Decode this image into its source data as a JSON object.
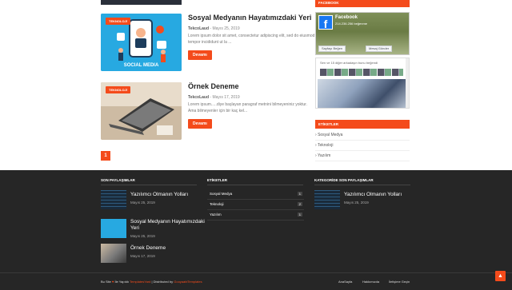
{
  "posts": [
    {
      "title": "Sosyal Medyanın Hayatımızdaki Yeri",
      "tag": "TEKNOLOJİ",
      "author": "TekcoLaud",
      "date": "Mayıs 25, 2019",
      "excerpt": "Lorem ipsum dolor sit amet, consectetur adipiscing elit, sed do eiusmod tempor incididunt ut la ...",
      "more": "Devamı",
      "thumb_label": "SOCIAL MEDIA"
    },
    {
      "title": "Örnek Deneme",
      "tag": "TEKNOLOJİ",
      "author": "TekcoLaud",
      "date": "Mayıs 17, 2019",
      "excerpt": "Lorem ipsum.....diye başlayan paragraf metnini bilmeyeniniz yoktur. Ama bilmeyenler için bir kaç kel...",
      "more": "Devamı"
    }
  ],
  "pager": {
    "current": "1"
  },
  "sidebar": {
    "facebook_head": "FACEBOOK",
    "facebook": {
      "name": "Facebook",
      "count": "214.236.256 beğenme",
      "like": "Sayfayı Beğen",
      "message": "Mesaj Gönder",
      "friends_text": "Sen ve 15 diğer arkadaşın bunu beğendi"
    },
    "labels_head": "ETİKETLER",
    "categories": [
      "Sosyal Medya",
      "Teknoloji",
      "Yazılım"
    ]
  },
  "footer": {
    "recent_head": "SON PAYLAŞIMLAR",
    "recent": [
      {
        "title": "Yazılımcı Olmanın Yolları",
        "date": "Mayıs 25, 2019"
      },
      {
        "title": "Sosyal Medyanın Hayatımızdaki",
        "title2": "Yeri",
        "date": "Mayıs 25, 2019"
      },
      {
        "title": "Örnek Deneme",
        "date": "Mayıs 17, 2019"
      }
    ],
    "labels_head": "ETİKETLER",
    "labels": [
      {
        "name": "Sosyal Medya",
        "count": "1"
      },
      {
        "name": "Teknoloji",
        "count": "2"
      },
      {
        "name": "Yazılım",
        "count": "1"
      }
    ],
    "category_head": "KATEGORİDE SON PAYLAŞIMLAR",
    "category_posts": [
      {
        "title": "Yazılımcı Olmanın Yolları",
        "date": "Mayıs 25, 2019"
      }
    ],
    "credit_prefix": "Bu Site",
    "credit_made": "İle Yapıldı",
    "credit_brand": "TemplatesYard",
    "credit_sep": "| Distributed by",
    "credit_dist": "GooyaabiTemplates",
    "menu": [
      "AnaSayfa",
      "Hakkımızda",
      "İletişime Geçin"
    ]
  },
  "colors": {
    "accent": "#f44b1b",
    "footer_bg": "#262626"
  },
  "icons": {
    "heart": "heart-icon",
    "arrow_up": "arrow-up-icon"
  }
}
